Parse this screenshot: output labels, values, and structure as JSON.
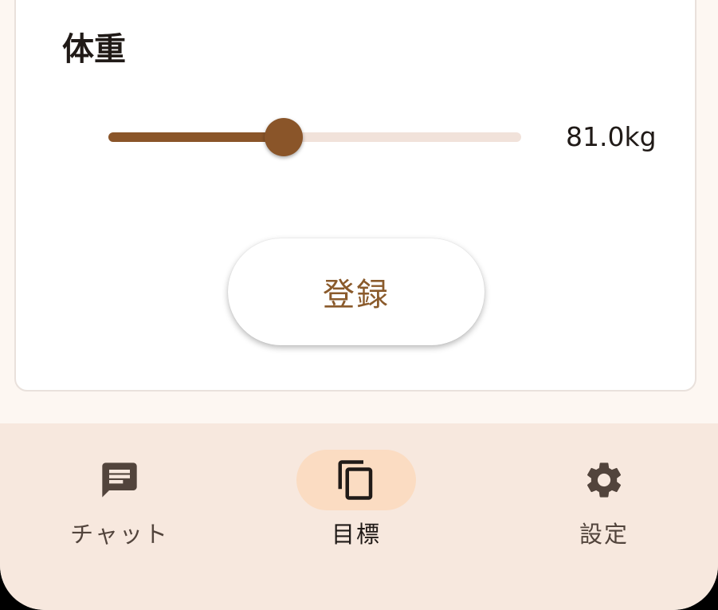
{
  "form": {
    "section_title": "体重",
    "weight_slider": {
      "min_fraction_label": "",
      "fraction": 0.425,
      "value_text": "81.0kg"
    },
    "register_label": "登録"
  },
  "bottom_nav": {
    "items": [
      {
        "label": "チャット",
        "icon": "chat-icon",
        "active": false
      },
      {
        "label": "目標",
        "icon": "copy-icon",
        "active": true
      },
      {
        "label": "設定",
        "icon": "gear-icon",
        "active": false
      }
    ]
  },
  "colors": {
    "accent": "#8a5529",
    "accent_track": "#f1e2da",
    "active_indicator": "#fbdcc2",
    "nav_background": "#f7e8de",
    "page_background": "#fdf7f2"
  }
}
